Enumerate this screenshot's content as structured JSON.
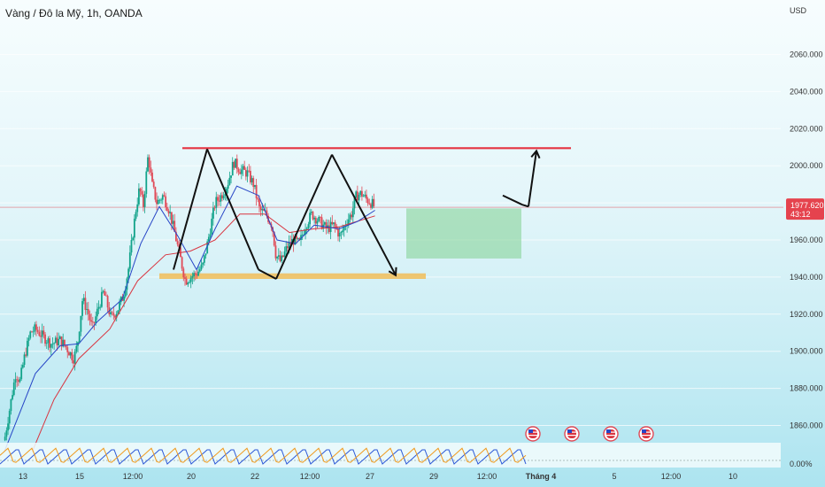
{
  "header": {
    "title": "Vàng / Đô la Mỹ, 1h, OANDA",
    "currency": "USD"
  },
  "colors": {
    "up": "#12a38a",
    "down": "#e04a57",
    "ma_fast": "#2745c6",
    "ma_slow": "#d9343f",
    "resistance": "#e53340",
    "support": "#f0c060",
    "range_box": "#7fcf90",
    "price_tag": "#e5434e"
  },
  "price_tag": {
    "price": "1977.620",
    "countdown": "43:12"
  },
  "events": {
    "icon": "us-flag-icon",
    "count": 4
  },
  "oscillator": {
    "value_label": "0.00%"
  },
  "chart_data": {
    "type": "candlestick",
    "title": "Vàng / Đô la Mỹ, 1h, OANDA",
    "y_unit": "USD",
    "ylim": [
      1846,
      2081
    ],
    "y_ticks": [
      1860,
      1880,
      1900,
      1920,
      1940,
      1960,
      1980,
      2000,
      2020,
      2040,
      2060
    ],
    "y_tick_labels": [
      "1860.000",
      "1880.000",
      "1900.000",
      "1920.000",
      "1940.000",
      "1960.000",
      "1980.000",
      "2000.000",
      "2020.000",
      "2040.000",
      "2060.000"
    ],
    "x_ticks": [
      "13",
      "15",
      "12:00",
      "20",
      "22",
      "12:00",
      "27",
      "29",
      "12:00",
      "Tháng 4",
      "5",
      "12:00",
      "10"
    ],
    "price_path": [
      {
        "t": 0,
        "p": 1852
      },
      {
        "t": 8,
        "p": 1868
      },
      {
        "t": 18,
        "p": 1888
      },
      {
        "t": 25,
        "p": 1884
      },
      {
        "t": 33,
        "p": 1898
      },
      {
        "t": 42,
        "p": 1910
      },
      {
        "t": 50,
        "p": 1912
      },
      {
        "t": 62,
        "p": 1908
      },
      {
        "t": 76,
        "p": 1904
      },
      {
        "t": 90,
        "p": 1906
      },
      {
        "t": 100,
        "p": 1902
      },
      {
        "t": 112,
        "p": 1896
      },
      {
        "t": 118,
        "p": 1904
      },
      {
        "t": 126,
        "p": 1928
      },
      {
        "t": 134,
        "p": 1922
      },
      {
        "t": 142,
        "p": 1912
      },
      {
        "t": 152,
        "p": 1924
      },
      {
        "t": 160,
        "p": 1932
      },
      {
        "t": 172,
        "p": 1918
      },
      {
        "t": 182,
        "p": 1922
      },
      {
        "t": 192,
        "p": 1930
      },
      {
        "t": 200,
        "p": 1944
      },
      {
        "t": 206,
        "p": 1960
      },
      {
        "t": 212,
        "p": 1976
      },
      {
        "t": 218,
        "p": 1988
      },
      {
        "t": 224,
        "p": 1978
      },
      {
        "t": 232,
        "p": 2006
      },
      {
        "t": 238,
        "p": 1990
      },
      {
        "t": 246,
        "p": 1980
      },
      {
        "t": 256,
        "p": 1984
      },
      {
        "t": 266,
        "p": 1976
      },
      {
        "t": 276,
        "p": 1962
      },
      {
        "t": 284,
        "p": 1950
      },
      {
        "t": 292,
        "p": 1938
      },
      {
        "t": 300,
        "p": 1940
      },
      {
        "t": 310,
        "p": 1942
      },
      {
        "t": 320,
        "p": 1946
      },
      {
        "t": 330,
        "p": 1962
      },
      {
        "t": 340,
        "p": 1980
      },
      {
        "t": 350,
        "p": 1984
      },
      {
        "t": 360,
        "p": 1990
      },
      {
        "t": 370,
        "p": 2002
      },
      {
        "t": 380,
        "p": 1998
      },
      {
        "t": 392,
        "p": 1996
      },
      {
        "t": 402,
        "p": 1990
      },
      {
        "t": 412,
        "p": 1976
      },
      {
        "t": 422,
        "p": 1974
      },
      {
        "t": 432,
        "p": 1968
      },
      {
        "t": 438,
        "p": 1952
      },
      {
        "t": 446,
        "p": 1948
      },
      {
        "t": 456,
        "p": 1956
      },
      {
        "t": 466,
        "p": 1960
      },
      {
        "t": 476,
        "p": 1958
      },
      {
        "t": 486,
        "p": 1968
      },
      {
        "t": 496,
        "p": 1974
      },
      {
        "t": 508,
        "p": 1970
      },
      {
        "t": 520,
        "p": 1966
      },
      {
        "t": 532,
        "p": 1968
      },
      {
        "t": 542,
        "p": 1962
      },
      {
        "t": 552,
        "p": 1970
      },
      {
        "t": 560,
        "p": 1974
      },
      {
        "t": 568,
        "p": 1984
      },
      {
        "t": 576,
        "p": 1985
      },
      {
        "t": 584,
        "p": 1982
      },
      {
        "t": 592,
        "p": 1980
      },
      {
        "t": 597,
        "p": 1978
      }
    ],
    "ma_fast": [
      {
        "t": 0,
        "p": 1846
      },
      {
        "t": 50,
        "p": 1888
      },
      {
        "t": 90,
        "p": 1903
      },
      {
        "t": 120,
        "p": 1904
      },
      {
        "t": 150,
        "p": 1916
      },
      {
        "t": 190,
        "p": 1928
      },
      {
        "t": 220,
        "p": 1958
      },
      {
        "t": 250,
        "p": 1978
      },
      {
        "t": 280,
        "p": 1962
      },
      {
        "t": 310,
        "p": 1944
      },
      {
        "t": 340,
        "p": 1966
      },
      {
        "t": 375,
        "p": 1989
      },
      {
        "t": 410,
        "p": 1984
      },
      {
        "t": 440,
        "p": 1960
      },
      {
        "t": 470,
        "p": 1958
      },
      {
        "t": 500,
        "p": 1968
      },
      {
        "t": 540,
        "p": 1966
      },
      {
        "t": 570,
        "p": 1970
      },
      {
        "t": 598,
        "p": 1976
      }
    ],
    "ma_slow": [
      {
        "t": 45,
        "p": 1846
      },
      {
        "t": 80,
        "p": 1874
      },
      {
        "t": 120,
        "p": 1896
      },
      {
        "t": 170,
        "p": 1912
      },
      {
        "t": 215,
        "p": 1938
      },
      {
        "t": 260,
        "p": 1952
      },
      {
        "t": 300,
        "p": 1954
      },
      {
        "t": 340,
        "p": 1960
      },
      {
        "t": 380,
        "p": 1974
      },
      {
        "t": 420,
        "p": 1974
      },
      {
        "t": 460,
        "p": 1964
      },
      {
        "t": 500,
        "p": 1966
      },
      {
        "t": 540,
        "p": 1967
      },
      {
        "t": 598,
        "p": 1973
      }
    ],
    "resistance_level": 2009.5,
    "support_zone": {
      "from": 1939,
      "to": 1942
    },
    "range_box": {
      "from": 1950,
      "to": 1977
    },
    "pattern_points": [
      [
        196,
        1944
      ],
      [
        234,
        2009
      ],
      [
        292,
        1944
      ],
      [
        312,
        1939
      ],
      [
        375,
        2006
      ],
      [
        447,
        1941
      ],
      [
        568,
        1984
      ],
      [
        590,
        1979
      ],
      [
        597,
        1978
      ],
      [
        606,
        2008
      ]
    ]
  }
}
